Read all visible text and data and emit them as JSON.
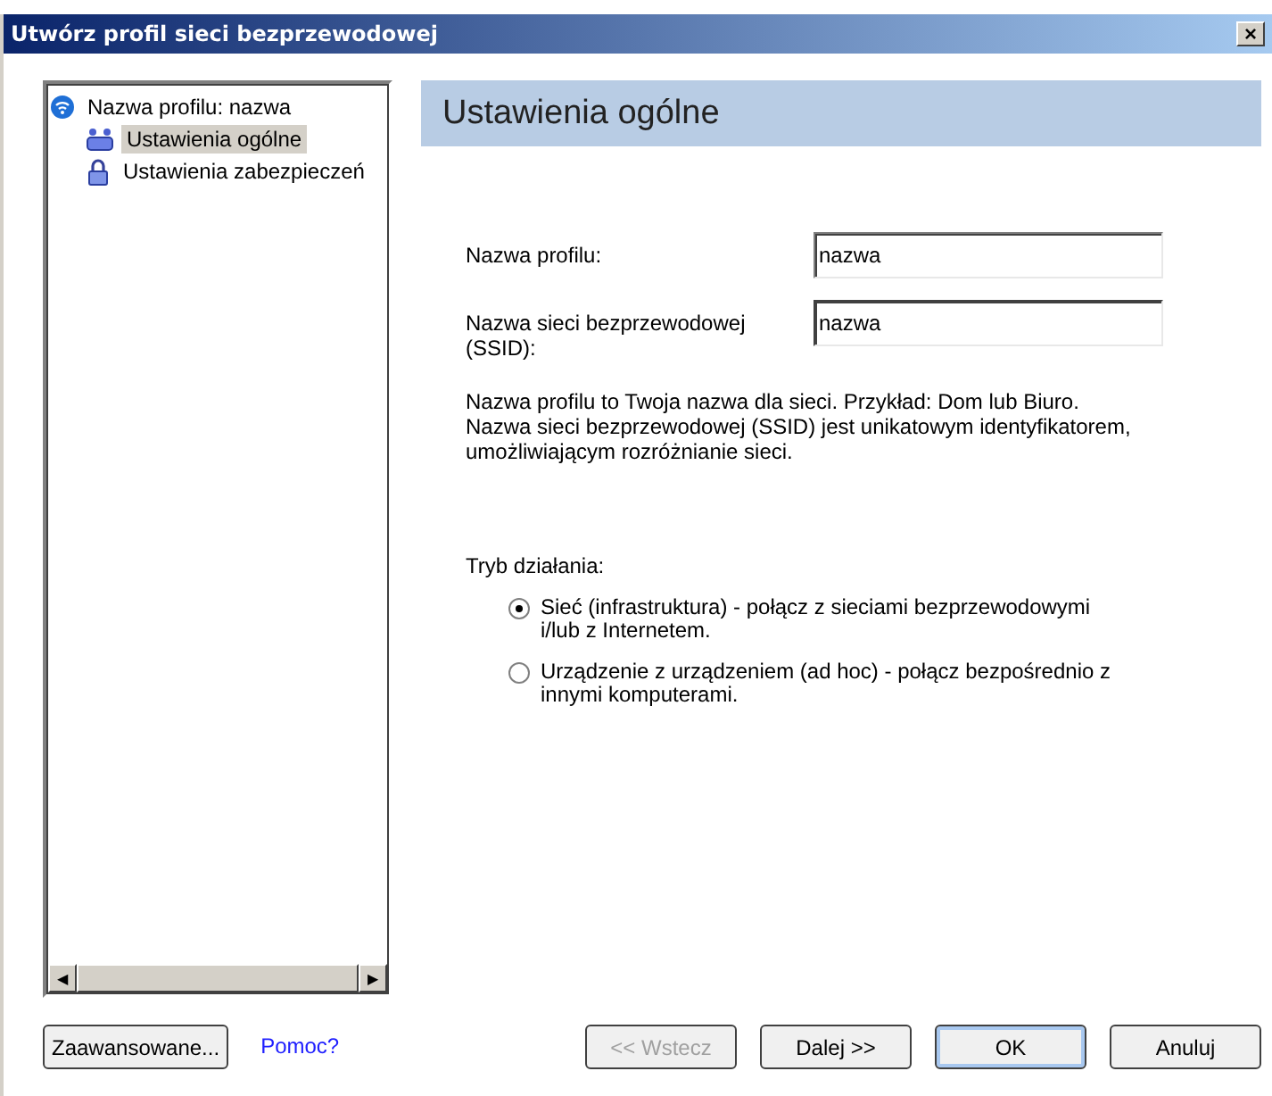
{
  "window": {
    "title": "Utwórz profil sieci bezprzewodowej",
    "close": "×"
  },
  "tree": [
    {
      "label": "Nazwa profilu: nazwa",
      "kind": "wifi",
      "selected": false,
      "children": [
        {
          "label": "Ustawienia ogólne",
          "kind": "users",
          "selected": true
        },
        {
          "label": "Ustawienia zabezpieczeń",
          "kind": "lock",
          "selected": false
        }
      ]
    }
  ],
  "tree_scrollbar": {
    "left": "◀",
    "right": "▶"
  },
  "header": "Ustawienia ogólne",
  "fields": [
    {
      "label": "Nazwa profilu:",
      "value": "nazwa",
      "focused": false
    },
    {
      "label": "Nazwa sieci bezprzewodowej (SSID):",
      "value": "nazwa",
      "focused": true
    }
  ],
  "description": "Nazwa profilu to Twoja nazwa dla sieci. Przykład: Dom lub Biuro. Nazwa sieci bezprzewodowej (SSID) jest unikatowym identyfikatorem, umożliwiającym rozróżnianie sieci.",
  "mode_label": "Tryb działania:",
  "modes": [
    {
      "label": "Sieć (infrastruktura) - połącz z sieciami bezprzewodowymi i/lub z Internetem.",
      "selected": true
    },
    {
      "label": "Urządzenie z urządzeniem (ad hoc) - połącz bezpośrednio z innymi komputerami.",
      "selected": false
    }
  ],
  "advanced_button": "Zaawansowane...",
  "help_link": "Pomoc?",
  "buttons": [
    {
      "label": "<< Wstecz",
      "disabled": true,
      "default": false
    },
    {
      "label": "Dalej >>",
      "disabled": false,
      "default": false
    },
    {
      "label": "OK",
      "disabled": false,
      "default": true
    },
    {
      "label": "Anuluj",
      "disabled": false,
      "default": false
    }
  ]
}
